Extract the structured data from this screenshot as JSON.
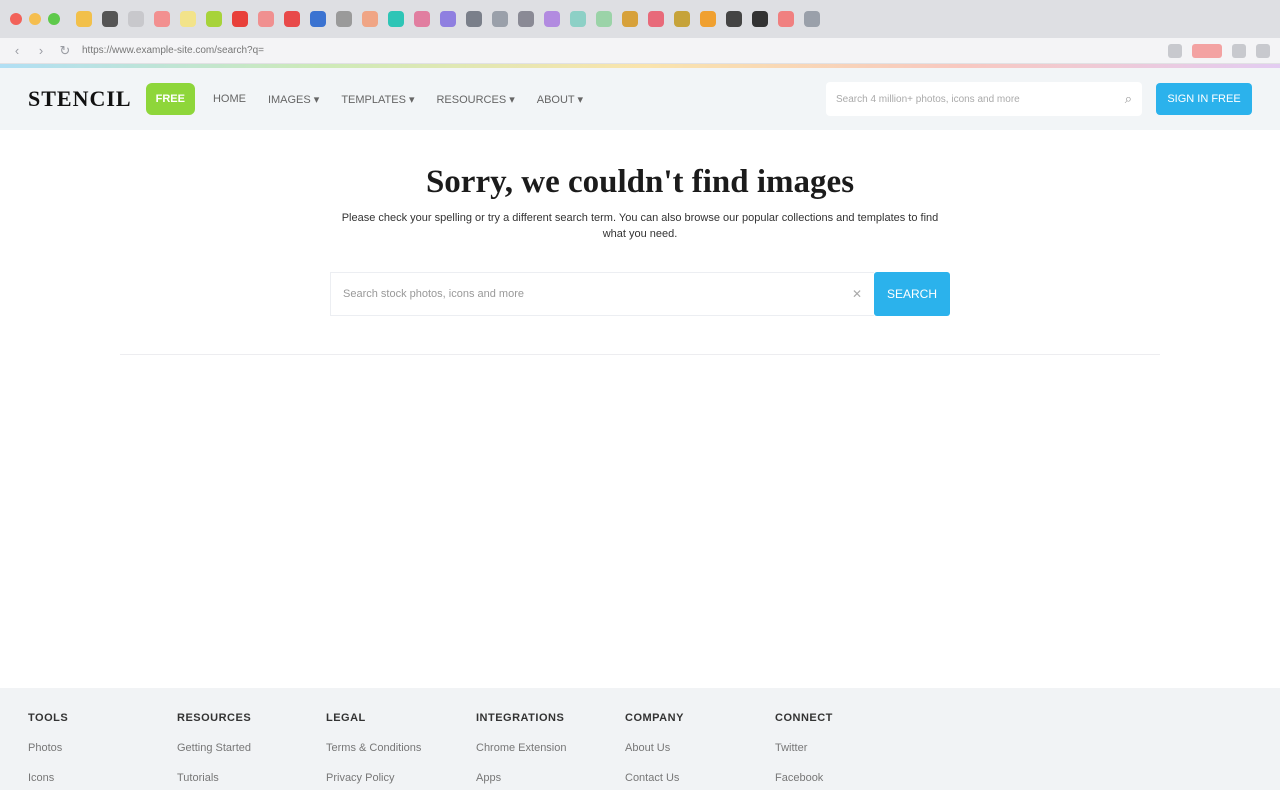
{
  "browser": {
    "tab_colors": [
      "#f2c04a",
      "#555555",
      "#c8c8cc",
      "#f29090",
      "#f2e38a",
      "#a7d33a",
      "#e8403a",
      "#f09090",
      "#e84a4a",
      "#3b73d1",
      "#9a9a9a",
      "#f0a585",
      "#2ec5b6",
      "#e17ea0",
      "#8f7fe0",
      "#7a7f8a",
      "#9aa0aa",
      "#8a8a95",
      "#b28be0",
      "#8dd0c6",
      "#9bd3a8",
      "#d7a13a",
      "#e86a7a",
      "#c6a33a",
      "#f0a030",
      "#444444",
      "#333333",
      "#f08080",
      "#9aa0aa"
    ],
    "url": "https://www.example-site.com/search?q=",
    "back_icon": "back-arrow-icon",
    "forward_icon": "forward-arrow-icon",
    "reload_icon": "reload-icon"
  },
  "header": {
    "logo": "STENCIL",
    "badge": "FREE",
    "nav": [
      "HOME",
      "IMAGES ▾",
      "TEMPLATES ▾",
      "RESOURCES ▾",
      "ABOUT ▾"
    ],
    "search_placeholder": "Search 4 million+ photos, icons and more",
    "search_icon": "search-icon",
    "signin_label": "SIGN IN FREE"
  },
  "hero": {
    "title": "Sorry, we couldn't find images",
    "subtitle": "Please check your spelling or try a different search term. You can also browse our popular collections and templates to find what you need.",
    "search_placeholder": "Search stock photos, icons and more",
    "clear_icon": "close-icon",
    "search_button": "SEARCH"
  },
  "footer": {
    "columns": [
      {
        "heading": "TOOLS",
        "items": [
          "Photos",
          "Icons"
        ]
      },
      {
        "heading": "RESOURCES",
        "items": [
          "Getting Started",
          "Tutorials"
        ]
      },
      {
        "heading": "LEGAL",
        "items": [
          "Terms & Conditions",
          "Privacy Policy"
        ]
      },
      {
        "heading": "INTEGRATIONS",
        "items": [
          "Chrome Extension",
          "Apps"
        ]
      },
      {
        "heading": "COMPANY",
        "items": [
          "About Us",
          "Contact Us"
        ]
      },
      {
        "heading": "CONNECT",
        "items": [
          "Twitter",
          "Facebook"
        ]
      }
    ]
  }
}
